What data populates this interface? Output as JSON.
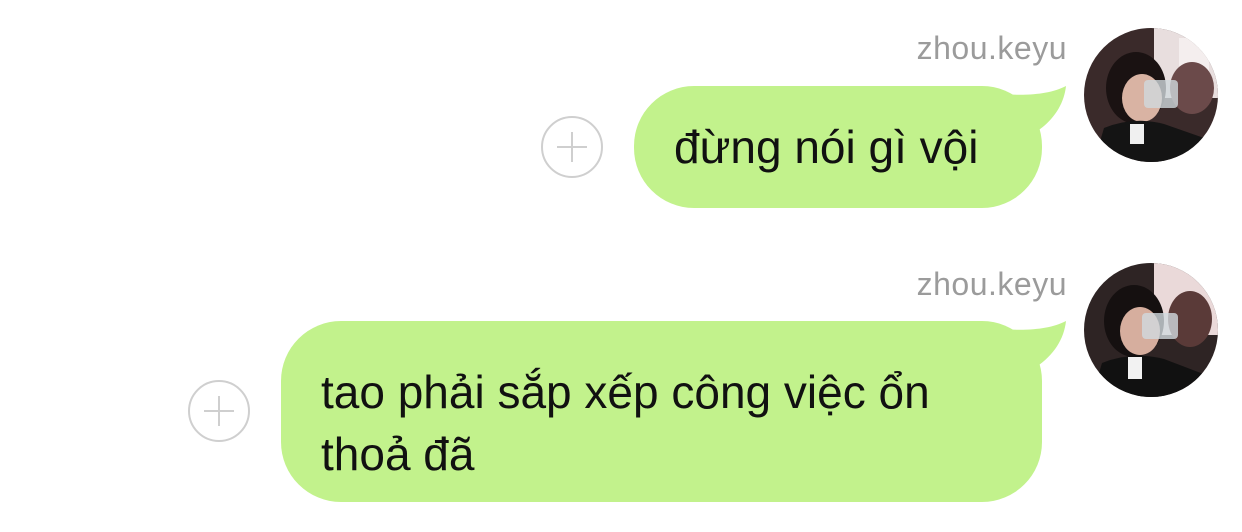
{
  "messages": [
    {
      "sender": "zhou.keyu",
      "text": "đừng nói gì vội"
    },
    {
      "sender": "zhou.keyu",
      "text": "tao phải sắp xếp công việc ổn thoả đã"
    }
  ],
  "icons": {
    "add": "plus-circle-icon",
    "avatar": "user-avatar-photo"
  },
  "colors": {
    "bubble": "#c2f28c",
    "sender_name": "#9b9b9b",
    "add_icon": "#cfcfcf",
    "background": "#ffffff"
  }
}
